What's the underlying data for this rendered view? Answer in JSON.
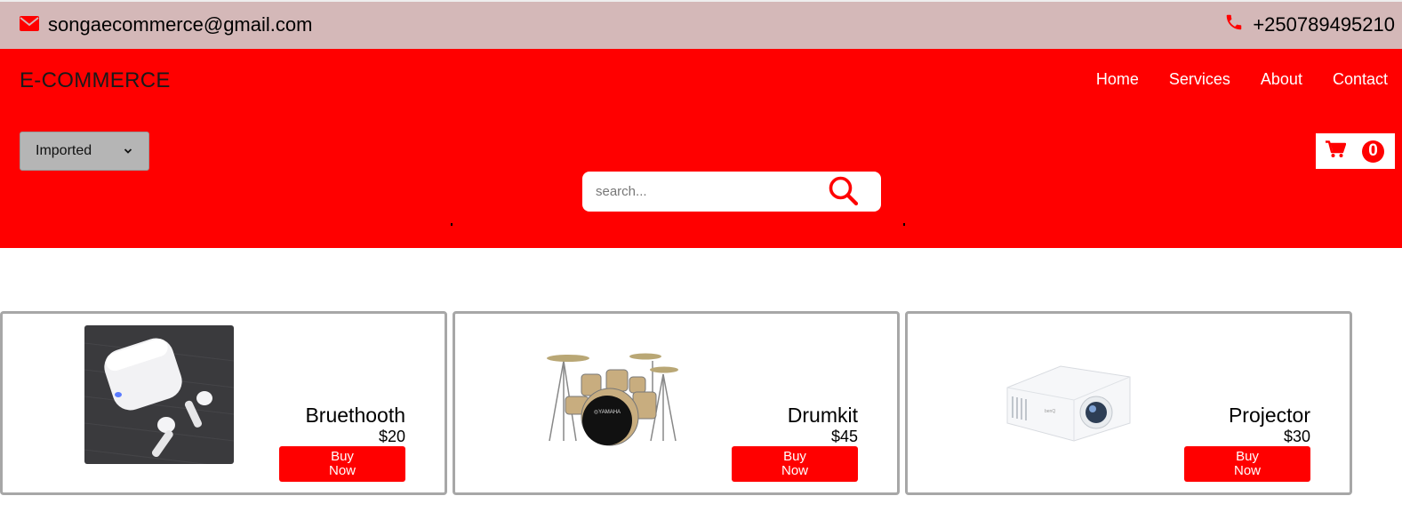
{
  "topbar": {
    "email": "songaecommerce@gmail.com",
    "phone": "+250789495210",
    "email_icon": "envelope-icon",
    "phone_icon": "phone-icon"
  },
  "header": {
    "brand": "E-COMMERCE",
    "nav": [
      "Home",
      "Services",
      "About",
      "Contact"
    ],
    "category_select": {
      "selected": "Imported"
    },
    "cart": {
      "icon": "cart-icon",
      "count": "0"
    },
    "search": {
      "placeholder": "search...",
      "icon": "search-icon"
    }
  },
  "products": [
    {
      "name": "Bruethooth",
      "price": "$20",
      "button": "Buy Now",
      "image": "wireless-earbuds-image"
    },
    {
      "name": "Drumkit",
      "price": "$45",
      "button": "Buy Now",
      "image": "drum-kit-image"
    },
    {
      "name": "Projector",
      "price": "$30",
      "button": "Buy Now",
      "image": "projector-image"
    }
  ],
  "colors": {
    "topbar_bg": "#d4b8b8",
    "header_bg": "#ff0000",
    "accent": "#ff0000",
    "card_border": "#a7a7a7"
  }
}
